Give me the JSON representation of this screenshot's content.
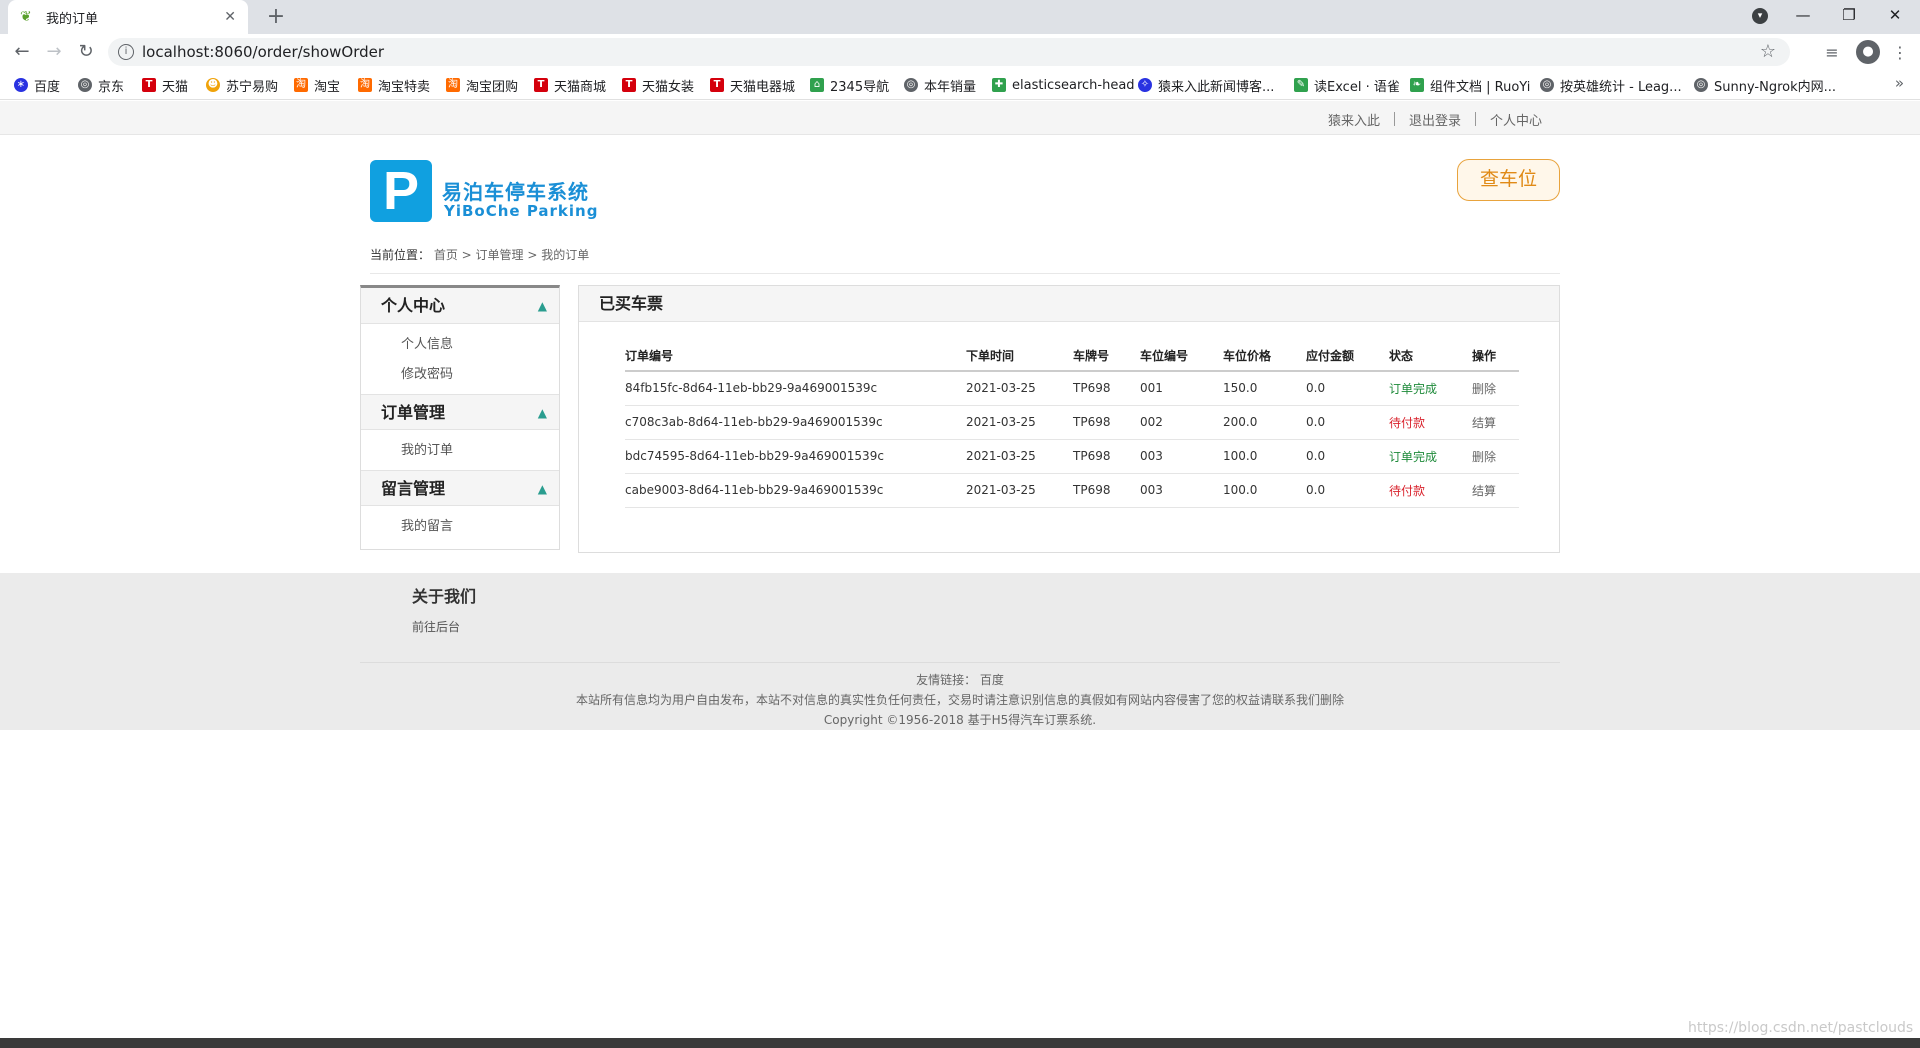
{
  "browser": {
    "tab_title": "我的订单",
    "new_tab": "+",
    "url": "localhost:8060/order/showOrder",
    "bookmarks": [
      "百度",
      "京东",
      "天猫",
      "苏宁易购",
      "淘宝",
      "淘宝特卖",
      "淘宝团购",
      "天猫商城",
      "天猫女装",
      "天猫电器城",
      "2345导航",
      "本年销量",
      "elasticsearch-head",
      "猿来入此新闻博客...",
      "读Excel · 语雀",
      "组件文档 | RuoYi",
      "按英雄统计 - Leag...",
      "Sunny-Ngrok内网..."
    ]
  },
  "topbar": {
    "links": [
      "猿来入此",
      "退出登录",
      "个人中心"
    ]
  },
  "header": {
    "logo_letter": "P",
    "logo_cn": "易泊车停车系统",
    "logo_en": "YiBoChe  Parking",
    "find_button": "查车位"
  },
  "breadcrumb": {
    "label": "当前位置：",
    "path": "首页 > 订单管理 > 我的订单"
  },
  "sidebar": {
    "sections": [
      {
        "title": "个人中心",
        "items": [
          "个人信息",
          "修改密码"
        ]
      },
      {
        "title": "订单管理",
        "items": [
          "我的订单"
        ]
      },
      {
        "title": "留言管理",
        "items": [
          "我的留言"
        ]
      }
    ]
  },
  "orders": {
    "title": "已买车票",
    "columns": [
      "订单编号",
      "下单时间",
      "车牌号",
      "车位编号",
      "车位价格",
      "应付金额",
      "状态",
      "操作"
    ],
    "rows": [
      {
        "id": "84fb15fc-8d64-11eb-bb29-9a469001539c",
        "time": "2021-03-25",
        "plate": "TP698",
        "spot": "001",
        "price": "150.0",
        "due": "0.0",
        "status": "订单完成",
        "action": "删除"
      },
      {
        "id": "c708c3ab-8d64-11eb-bb29-9a469001539c",
        "time": "2021-03-25",
        "plate": "TP698",
        "spot": "002",
        "price": "200.0",
        "due": "0.0",
        "status": "待付款",
        "action": "结算"
      },
      {
        "id": "bdc74595-8d64-11eb-bb29-9a469001539c",
        "time": "2021-03-25",
        "plate": "TP698",
        "spot": "003",
        "price": "100.0",
        "due": "0.0",
        "status": "订单完成",
        "action": "删除"
      },
      {
        "id": "cabe9003-8d64-11eb-bb29-9a469001539c",
        "time": "2021-03-25",
        "plate": "TP698",
        "spot": "003",
        "price": "100.0",
        "due": "0.0",
        "status": "待付款",
        "action": "结算"
      }
    ]
  },
  "footer": {
    "about": "关于我们",
    "backend": "前往后台",
    "links_label": "友情链接：",
    "links": "百度",
    "disclaimer": "本站所有信息均为用户自由发布，本站不对信息的真实性负任何责任，交易时请注意识别信息的真假如有网站内容侵害了您的权益请联系我们删除",
    "copyright": "Copyright ©1956-2018 基于H5得汽车订票系统."
  },
  "watermark": "https://blog.csdn.net/pastclouds",
  "colors": {
    "status_done": "#1e8a3a",
    "status_pending": "#d9232d",
    "logo_blue": "#10a0e0",
    "find_orange": "#e08a16"
  }
}
